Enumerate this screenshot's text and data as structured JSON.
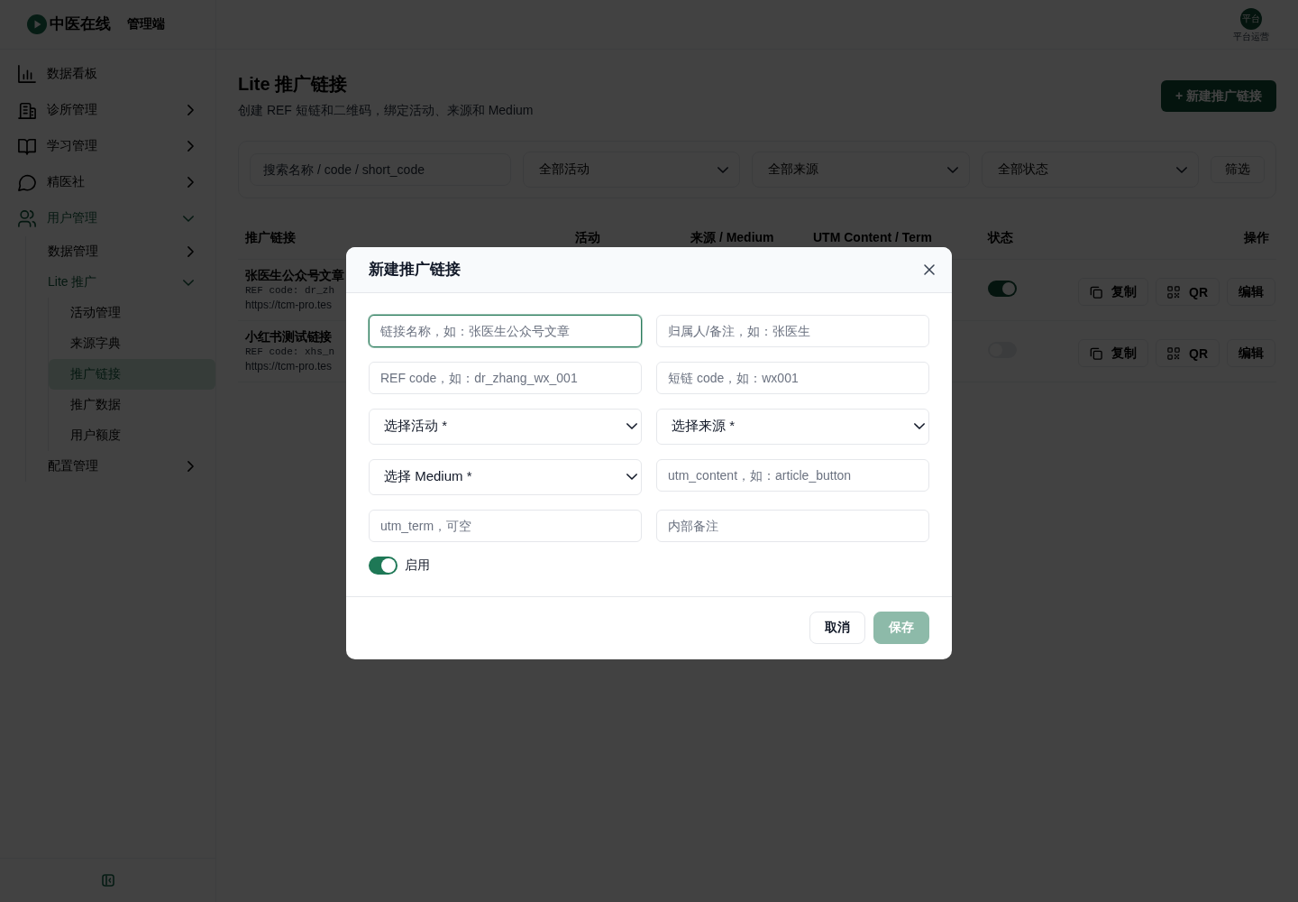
{
  "brand": {
    "name": "中医在线",
    "subtitle": "管理端"
  },
  "user": {
    "avatar_text": "平台",
    "role": "平台运营"
  },
  "sidebar": {
    "items": [
      {
        "label": "数据看板",
        "kind": "link",
        "selected": false
      },
      {
        "label": "诊所管理",
        "kind": "group",
        "expanded": false,
        "selected": false
      },
      {
        "label": "学习管理",
        "kind": "group",
        "expanded": false,
        "selected": false
      },
      {
        "label": "精医社",
        "kind": "group",
        "expanded": false,
        "selected": false
      },
      {
        "label": "用户管理",
        "kind": "group",
        "expanded": true,
        "selected": false,
        "children": [
          {
            "label": "数据管理",
            "kind": "group",
            "expanded": false,
            "selected": false
          },
          {
            "label": "Lite 推广",
            "kind": "group",
            "expanded": true,
            "selected": false,
            "children": [
              {
                "label": "活动管理",
                "kind": "link",
                "selected": false
              },
              {
                "label": "来源字典",
                "kind": "link",
                "selected": false
              },
              {
                "label": "推广链接",
                "kind": "link",
                "selected": true
              },
              {
                "label": "推广数据",
                "kind": "link",
                "selected": false
              },
              {
                "label": "用户额度",
                "kind": "link",
                "selected": false
              }
            ]
          },
          {
            "label": "配置管理",
            "kind": "group",
            "expanded": false,
            "selected": false
          }
        ]
      }
    ]
  },
  "page": {
    "title": "Lite 推广链接",
    "subtitle": "创建 REF 短链和二维码，绑定活动、来源和 Medium",
    "new_button": "+ 新建推广链接"
  },
  "filters": {
    "search": {
      "placeholder": "搜索名称 / code / short_code"
    },
    "selects": [
      {
        "value": "全部活动"
      },
      {
        "value": "全部来源"
      },
      {
        "value": "全部状态"
      }
    ],
    "button": "筛选"
  },
  "table": {
    "columns": [
      "推广链接",
      "活动",
      "来源 / Medium",
      "UTM Content / Term",
      "状态",
      "操作"
    ],
    "rows": [
      {
        "name": "张医生公众号文章",
        "ref_code": "REF code: dr_zh",
        "url": "https://tcm-pro.tes",
        "enabled": true,
        "actions": [
          {
            "kind": "copy",
            "label": "复制"
          },
          {
            "kind": "qr",
            "label": "QR"
          },
          {
            "kind": "edit",
            "label": "编辑"
          }
        ]
      },
      {
        "name": "小红书测试链接",
        "ref_code": "REF code: xhs_n",
        "url": "https://tcm-pro.tes",
        "enabled": false,
        "actions": [
          {
            "kind": "copy",
            "label": "复制"
          },
          {
            "kind": "qr",
            "label": "QR"
          },
          {
            "kind": "edit",
            "label": "编辑"
          }
        ]
      }
    ]
  },
  "modal": {
    "title": "新建推广链接",
    "fields": [
      {
        "kind": "input",
        "placeholder": "链接名称，如：张医生公众号文章",
        "focused": true
      },
      {
        "kind": "input",
        "placeholder": "归属人/备注，如：张医生",
        "focused": false
      },
      {
        "kind": "input",
        "placeholder": "REF code，如：dr_zhang_wx_001",
        "focused": false
      },
      {
        "kind": "input",
        "placeholder": "短链 code，如：wx001",
        "focused": false
      },
      {
        "kind": "select",
        "value": "选择活动 *",
        "focused": false
      },
      {
        "kind": "select",
        "value": "选择来源 *",
        "focused": false
      },
      {
        "kind": "select",
        "value": "选择 Medium *",
        "focused": false
      },
      {
        "kind": "input",
        "placeholder": "utm_content，如：article_button",
        "focused": false
      },
      {
        "kind": "input",
        "placeholder": "utm_term，可空",
        "focused": false
      },
      {
        "kind": "input",
        "placeholder": "内部备注",
        "focused": false
      }
    ],
    "toggle": {
      "label": "启用",
      "on": true
    },
    "buttons": [
      {
        "kind": "secondary",
        "label": "取消",
        "disabled": false
      },
      {
        "kind": "primary",
        "label": "保存",
        "disabled": true
      }
    ]
  }
}
